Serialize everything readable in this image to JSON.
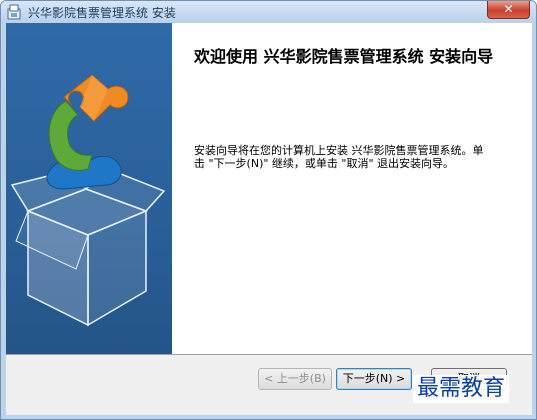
{
  "window": {
    "title": "兴华影院售票管理系统 安装",
    "close_label": "✕",
    "icon": "installer-icon"
  },
  "sidebar": {
    "illustration": "puzzle-box-icon"
  },
  "content": {
    "heading": "欢迎使用 兴华影院售票管理系统 安装向导",
    "body": "安装向导将在您的计算机上安装 兴华影院售票管理系统。单击 \"下一步(N)\" 继续，或单击 \"取消\" 退出安装向导。"
  },
  "buttons": {
    "back": "< 上一步(B)",
    "next": "下一步(N) >",
    "cancel": "取消"
  },
  "watermark": {
    "text": "最需教育"
  },
  "colors": {
    "sidebar": "#2a5f98",
    "accent_orange": "#f08a24",
    "accent_green": "#5fa83a",
    "accent_blue": "#1f77c8"
  }
}
